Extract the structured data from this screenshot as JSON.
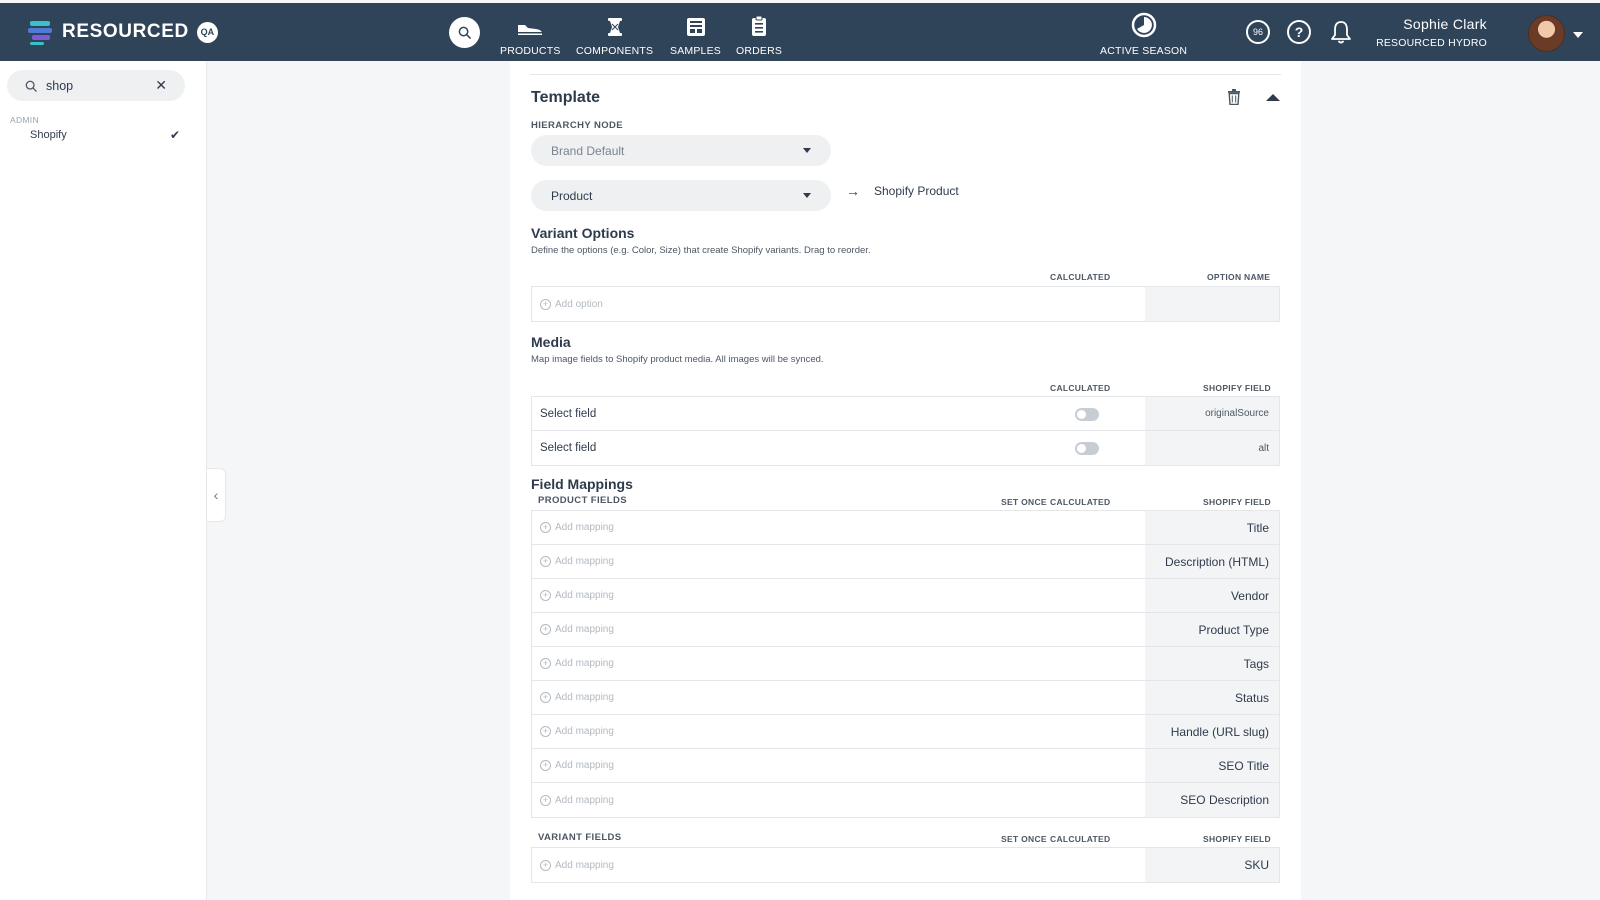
{
  "app": {
    "brand": "RESOURCED",
    "env_badge": "QA",
    "colors": {
      "topbar": "#2f4359",
      "sidebar_bg": "#ffffff",
      "page_bg": "#f5f6f7",
      "text": "#2f3b4c"
    }
  },
  "nav": {
    "items": [
      {
        "label": "PRODUCTS",
        "icon": "shoe-icon"
      },
      {
        "label": "COMPONENTS",
        "icon": "spool-icon"
      },
      {
        "label": "SAMPLES",
        "icon": "samples-icon"
      },
      {
        "label": "ORDERS",
        "icon": "clipboard-icon"
      }
    ],
    "season_label": "ACTIVE SEASON",
    "score": "96"
  },
  "user": {
    "name": "Sophie Clark",
    "org": "RESOURCED HYDRO"
  },
  "sidebar": {
    "search_value": "shop",
    "section": "ADMIN",
    "items": [
      {
        "label": "Shopify",
        "checked": true
      }
    ]
  },
  "template": {
    "title": "Template",
    "hierarchy_label": "HIERARCHY NODE",
    "hierarchy_value": "Brand Default",
    "entity_value": "Product",
    "entity_target": "Shopify Product"
  },
  "variant_options": {
    "title": "Variant Options",
    "desc": "Define the options (e.g. Color, Size) that create Shopify variants. Drag to reorder.",
    "col_calculated": "CALCULATED",
    "col_option_name": "OPTION NAME",
    "add_label": "Add option"
  },
  "media": {
    "title": "Media",
    "desc": "Map image fields to Shopify product media. All images will be synced.",
    "col_calculated": "CALCULATED",
    "col_shopify_field": "SHOPIFY FIELD",
    "rows": [
      {
        "label": "Select field",
        "field": "originalSource",
        "calculated": false
      },
      {
        "label": "Select field",
        "field": "alt",
        "calculated": false
      }
    ]
  },
  "field_mappings": {
    "title": "Field Mappings",
    "product_fields_label": "PRODUCT FIELDS",
    "col_set_once": "SET ONCE",
    "col_calculated": "CALCULATED",
    "col_shopify_field": "SHOPIFY FIELD",
    "add_label": "Add mapping",
    "product_rows": [
      "Title",
      "Description (HTML)",
      "Vendor",
      "Product Type",
      "Tags",
      "Status",
      "Handle (URL slug)",
      "SEO Title",
      "SEO Description"
    ],
    "variant_fields_label": "VARIANT FIELDS",
    "variant_rows": [
      "SKU"
    ]
  }
}
